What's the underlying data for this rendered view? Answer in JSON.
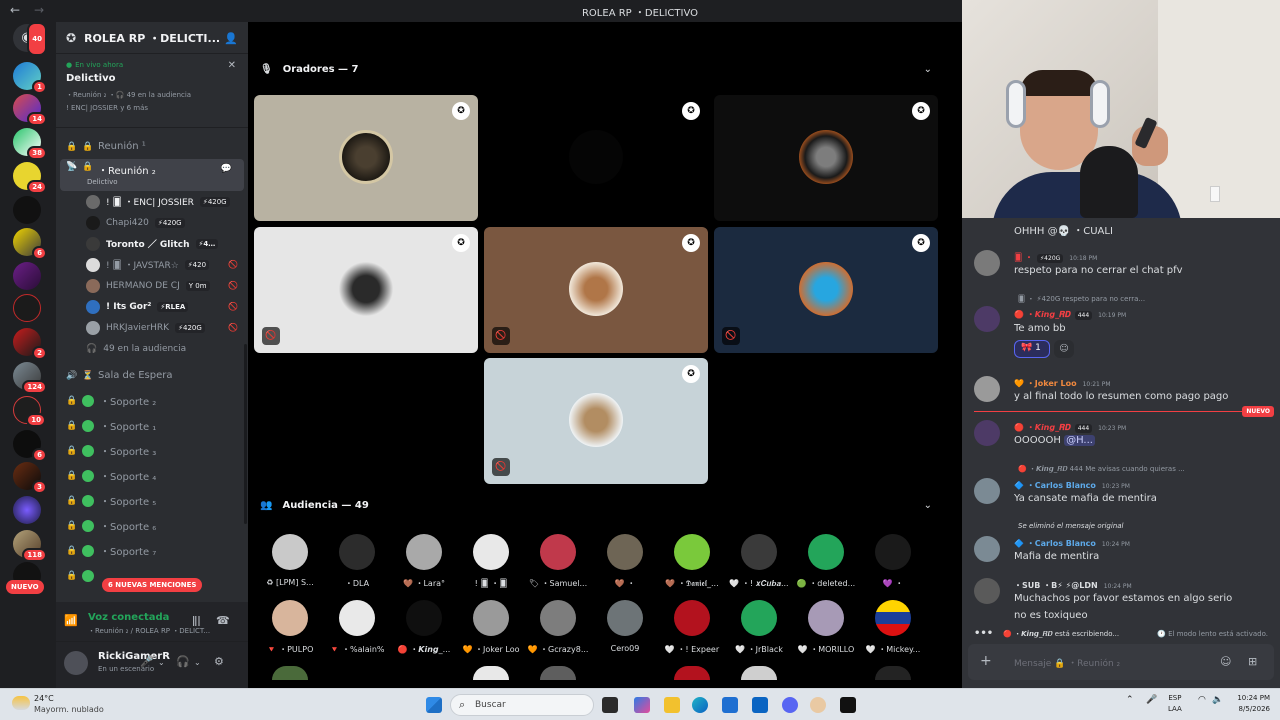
{
  "window": {
    "title": "ROLEA RP ・DELICTIVO",
    "back_icon": "←",
    "forward_icon": "→"
  },
  "servers": [
    {
      "badge": "40"
    },
    {
      "badge": "1"
    },
    {
      "badge": "14"
    },
    {
      "badge": "38"
    },
    {
      "badge": "24"
    },
    {
      "badge": ""
    },
    {
      "badge": "6"
    },
    {
      "badge": ""
    },
    {
      "badge": ""
    },
    {
      "badge": "2"
    },
    {
      "badge": "124"
    },
    {
      "badge": "10"
    },
    {
      "badge": "6"
    },
    {
      "badge": "3"
    },
    {
      "badge": ""
    },
    {
      "badge": "118"
    },
    {
      "badge": ""
    }
  ],
  "server_rail": {
    "nuevo": "NUEVO"
  },
  "sidebar": {
    "server_name": "ROLEA RP ・DELICTI...",
    "live": {
      "now": "En vivo ahora",
      "stage": "Delictivo",
      "meta": "・Reunión ₂ ・🎧 49 en la audiencia",
      "meta2": "! ENC| JOSSIER y 6 más"
    },
    "channels": {
      "reunion1": "Reunión ¹",
      "reunion2": "・Reunión ₂",
      "reunion2_sub": "Delictivo",
      "sala": "Sala de Espera",
      "soporte": [
        "・Soporte ₂",
        "・Soporte ₁",
        "・Soporte ₃",
        "・Soporte ₄",
        "・Soporte ₅",
        "・Soporte ₆",
        "・Soporte ₇"
      ]
    },
    "members": [
      {
        "name": "! 🂠 ・ENC| JOSSIER",
        "tag": "⚡420G"
      },
      {
        "name": "Chapi420",
        "tag": "⚡420G"
      },
      {
        "name": "Toronto ／ Glitch",
        "tag": "⚡4…"
      },
      {
        "name": "! 🂠 ・JAVSTAR☆",
        "tag": "⚡420"
      },
      {
        "name": "HERMANO DE CJ",
        "tag": "Y 0m"
      },
      {
        "name": "! Its Gor²",
        "tag": "⚡RLEA"
      },
      {
        "name": "HRKJavierHRK",
        "tag": "⚡420G"
      }
    ],
    "audience": "49 en la audiencia",
    "mentions": "6 NUEVAS MENCIONES",
    "voice": {
      "connected": "Voz conectada",
      "channel": "・Reunión ₂ / ROLEA RP ・DELICT..."
    },
    "user": {
      "name": "RickiGamerR",
      "status": "En un escenario"
    }
  },
  "stage": {
    "speakers_header": "Oradores — 7",
    "audience_header": "Audiencia — 49",
    "audience": [
      "♻ [LPM] S...",
      "・DLA",
      "🤎 ・Lara°",
      "! 🂠 ・🂠",
      "🏷 ・Samuel...",
      "🤎 ・",
      "🤎 ・𝕯𝖆𝖓𝖎𝖊𝖑_...",
      "🤍 ・! 𝒙𝑪𝒖𝒃𝒂...",
      "🟢 ・deleted...",
      "💜 ・",
      "🔻 ・PULPO",
      "🔻 ・%alain%",
      "🔴 ・𝙆𝙞𝙣𝙜_...",
      "🧡 ・Joker Loo",
      "🧡 ・Gcrazy8...",
      "Cero09",
      "🤍 ・! Expeer",
      "🤍 ・JrBlack",
      "🤍 ・MORILLO",
      "🤍 ・Mickey..."
    ]
  },
  "colors": {
    "accent": "#5865f2",
    "online": "#23a55a",
    "danger": "#f23f43",
    "sidebar": "#2b2d31",
    "chat": "#313338"
  },
  "chat": {
    "messages": [
      {
        "name": "",
        "time": "",
        "text": "OHHH @💀 ・CUALI"
      },
      {
        "name": "🂠 ・",
        "tag": "⚡420G",
        "time": "10:18 PM",
        "text": "respeto para no cerrar el chat pfv"
      },
      {
        "reply": "🂠 ・ ⚡420G  respeto para no cerra...",
        "name": "🔴 ・𝙆𝙞𝙣𝙜_𝑹𝑫",
        "tag": "444",
        "time": "10:19 PM",
        "text": "Te amo bb"
      },
      {
        "name": "🧡 ・Joker Loo",
        "time": "10:21 PM",
        "text": "y al final todo lo resumen como pago pago"
      },
      {
        "name": "🔴 ・𝙆𝙞𝙣𝙜_𝑹𝑫",
        "tag": "444",
        "time": "10:23 PM",
        "text": "OOOOOH ",
        "mention": "@H..."
      },
      {
        "reply": "🔴 ・𝙆𝙞𝙣𝙜_𝑹𝑫 444  Me avisas cuando quieras ...",
        "name": "🔷 ・Carlos Blanco",
        "time": "10:23 PM",
        "text": "Ya cansate mafia de mentira"
      },
      {
        "reply": "Se eliminó el mensaje original",
        "name": "🔷 ・Carlos Blanco",
        "time": "10:24 PM",
        "text": "Mafia de mentira"
      },
      {
        "name": "・SUB ・B⚡ ⚡@LDN",
        "time": "10:24 PM",
        "text": "Muchachos por favor estamos en algo serio",
        "text2": "no es toxiqueo"
      }
    ],
    "reaction_count": "1",
    "new_badge": "NUEVO",
    "typing": "🔴 ・𝙆𝙞𝙣𝙜_𝑹𝑫 está escribiendo...",
    "slowmode": "El modo lento está activado.",
    "compose_placeholder": "Mensaje 🔒 ・Reunión ₂"
  },
  "taskbar": {
    "temp": "24°C",
    "weather": "Mayorm. nublado",
    "search": "Buscar",
    "lang1": "ESP",
    "lang2": "LAA",
    "time": "10:24 PM",
    "date": "8/5/2026"
  }
}
